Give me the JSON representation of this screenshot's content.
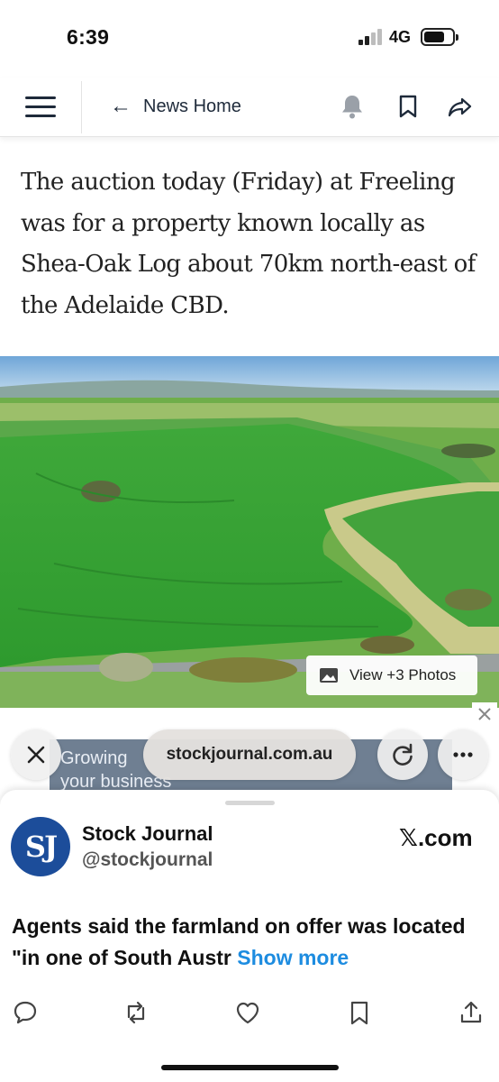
{
  "status_bar": {
    "time": "6:39",
    "network": "4G"
  },
  "nav": {
    "back_label": "News Home"
  },
  "article": {
    "paragraph": "The auction today (Friday) at Freeling was for a property known locally as Shea-Oak Log about 70km north-east of the Adelaide CBD."
  },
  "photo": {
    "view_label": "View +3 Photos"
  },
  "ad": {
    "line1": "Growing",
    "line2": "your business"
  },
  "browser": {
    "url": "stockjournal.com.au"
  },
  "sheet": {
    "avatar_text": "SJ",
    "account_name": "Stock Journal",
    "account_handle": "@stockjournal",
    "source_x": "𝕏",
    "source_rest": ".com",
    "tweet_text": "Agents said the farmland on offer was located \"in one of South Austr",
    "show_more": "Show more"
  },
  "colors": {
    "accent_link": "#1d8ce0",
    "avatar_bg": "#1c4d9a",
    "nav_ink": "#1e2a3a"
  },
  "icons": [
    "hamburger-menu-icon",
    "back-arrow-icon",
    "bell-icon",
    "bookmark-icon",
    "share-icon",
    "gallery-icon",
    "close-icon",
    "reload-icon",
    "more-icon",
    "reply-icon",
    "retweet-icon",
    "like-icon",
    "bookmark-icon",
    "upload-icon"
  ]
}
